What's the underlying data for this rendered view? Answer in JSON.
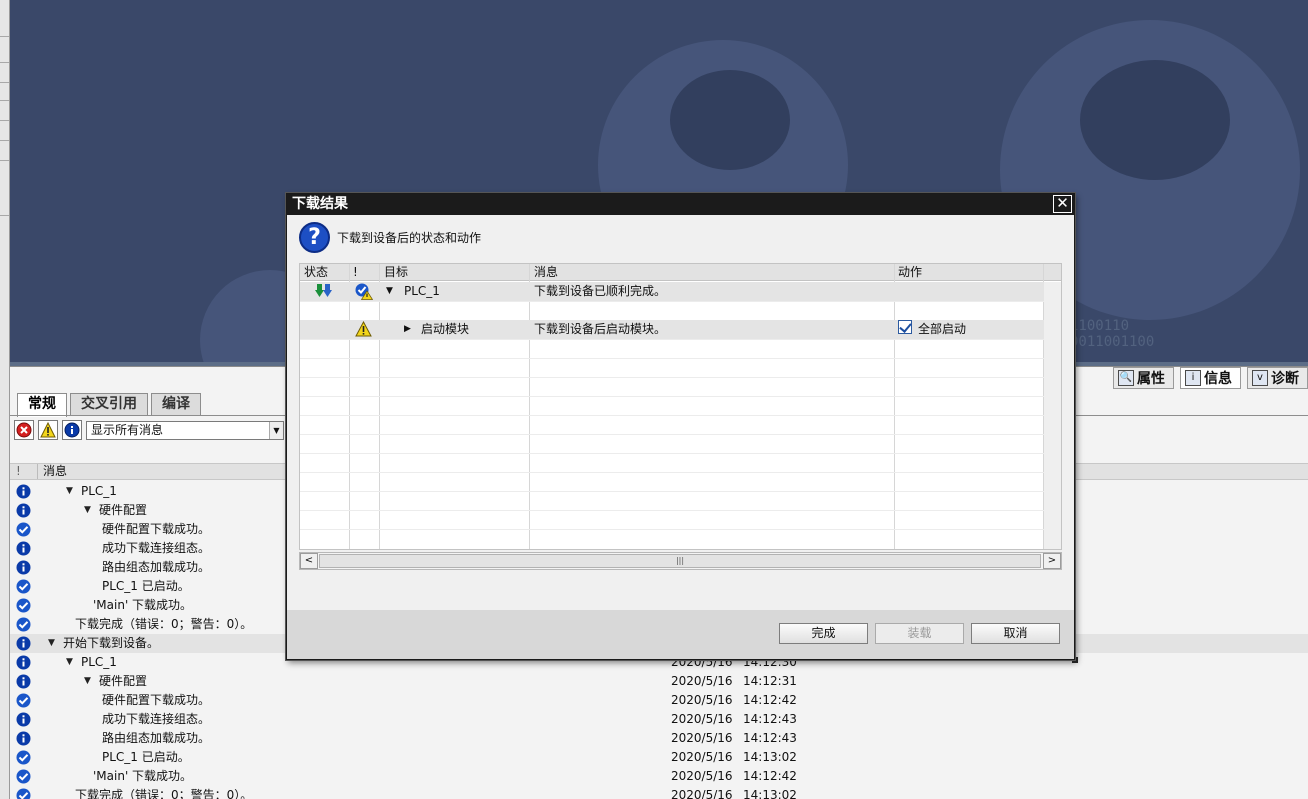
{
  "dialog": {
    "title": "下载结果",
    "close_symbol": "✕",
    "subtitle": "下载到设备后的状态和动作",
    "columns": {
      "status": "状态",
      "bang": "!",
      "target": "目标",
      "message": "消息",
      "action": "动作"
    },
    "rows": [
      {
        "target": "PLC_1",
        "message": "下载到设备已顺利完成。",
        "action": ""
      },
      {
        "target": "启动模块",
        "message": "下载到设备后启动模块。",
        "action": "全部启动",
        "action_checked": true
      }
    ],
    "buttons": {
      "finish": "完成",
      "load": "装载",
      "cancel": "取消"
    }
  },
  "inspector_tabs": [
    "属性",
    "信息",
    "诊断"
  ],
  "panel": {
    "tabs": [
      "常规",
      "交叉引用",
      "编译"
    ],
    "filter_value": "显示所有消息",
    "list_header": {
      "bang": "!",
      "message": "消息"
    },
    "messages": [
      {
        "icon": "info-icon",
        "indent": 0,
        "expander": "▼",
        "text": "PLC_1",
        "date": "",
        "time": ""
      },
      {
        "icon": "info-icon",
        "indent": 1,
        "expander": "▼",
        "text": "硬件配置",
        "date": "",
        "time": ""
      },
      {
        "icon": "success-icon",
        "indent": 2,
        "expander": "",
        "text": "硬件配置下载成功。",
        "date": "",
        "time": ""
      },
      {
        "icon": "info-icon",
        "indent": 2,
        "expander": "",
        "text": "成功下载连接组态。",
        "date": "",
        "time": ""
      },
      {
        "icon": "info-icon",
        "indent": 2,
        "expander": "",
        "text": "路由组态加载成功。",
        "date": "",
        "time": ""
      },
      {
        "icon": "success-icon",
        "indent": 2,
        "expander": "",
        "text": "PLC_1 已启动。",
        "date": "",
        "time": ""
      },
      {
        "icon": "success-icon",
        "indent": 1.5,
        "expander": "",
        "text": "'Main' 下载成功。",
        "date": "",
        "time": ""
      },
      {
        "icon": "success-icon",
        "indent": 0.5,
        "expander": "",
        "text": "下载完成（错误：0；警告：0）。",
        "date": "",
        "time": ""
      },
      {
        "icon": "info-icon",
        "indent": -1,
        "expander": "▼",
        "text": "开始下载到设备。",
        "date": "",
        "time": "",
        "selected": true
      },
      {
        "icon": "info-icon",
        "indent": 0,
        "expander": "▼",
        "text": "PLC_1",
        "date": "2020/5/16",
        "time": "14:12:30"
      },
      {
        "icon": "info-icon",
        "indent": 1,
        "expander": "▼",
        "text": "硬件配置",
        "date": "2020/5/16",
        "time": "14:12:31"
      },
      {
        "icon": "success-icon",
        "indent": 2,
        "expander": "",
        "text": "硬件配置下载成功。",
        "date": "2020/5/16",
        "time": "14:12:42"
      },
      {
        "icon": "info-icon",
        "indent": 2,
        "expander": "",
        "text": "成功下载连接组态。",
        "date": "2020/5/16",
        "time": "14:12:43"
      },
      {
        "icon": "info-icon",
        "indent": 2,
        "expander": "",
        "text": "路由组态加载成功。",
        "date": "2020/5/16",
        "time": "14:12:43"
      },
      {
        "icon": "success-icon",
        "indent": 2,
        "expander": "",
        "text": "PLC_1 已启动。",
        "date": "2020/5/16",
        "time": "14:13:02"
      },
      {
        "icon": "success-icon",
        "indent": 1.5,
        "expander": "",
        "text": "'Main' 下载成功。",
        "date": "2020/5/16",
        "time": "14:12:42"
      },
      {
        "icon": "success-icon",
        "indent": 0.5,
        "expander": "",
        "text": "下载完成（错误：0；警告：0）。",
        "date": "2020/5/16",
        "time": "14:13:02"
      }
    ]
  },
  "colors": {
    "workspace_bg": "#3a4869",
    "dialog_title_bg": "#1b1b1b",
    "info_blue": "#0a3aa8",
    "success_blue": "#1a56c9",
    "warning_yellow": "#f2d51b",
    "error_red": "#d42020"
  }
}
